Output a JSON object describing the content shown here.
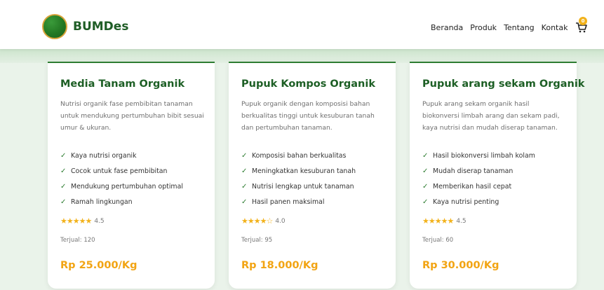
{
  "header": {
    "brand": "BUMDes",
    "nav": [
      "Beranda",
      "Produk",
      "Tentang",
      "Kontak"
    ],
    "cart_count": "0"
  },
  "products": [
    {
      "title": "Media Tanam Organik",
      "description": "Nutrisi organik fase pembibitan tanaman untuk mendukung pertumbuhan bibit sesuai umur & ukuran.",
      "features": [
        "Kaya nutrisi organik",
        "Cocok untuk fase pembibitan",
        "Mendukung pertumbuhan optimal",
        "Ramah lingkungan"
      ],
      "stars": "★★★★★",
      "rating": "4.5",
      "sold": "Terjual: 120",
      "price": "Rp 25.000/Kg"
    },
    {
      "title": "Pupuk Kompos Organik",
      "description": "Pupuk organik dengan komposisi bahan berkualitas tinggi untuk kesuburan tanah dan pertumbuhan tanaman.",
      "features": [
        "Komposisi bahan berkualitas",
        "Meningkatkan kesuburan tanah",
        "Nutrisi lengkap untuk tanaman",
        "Hasil panen maksimal"
      ],
      "stars": "★★★★☆",
      "rating": "4.0",
      "sold": "Terjual: 95",
      "price": "Rp 18.000/Kg"
    },
    {
      "title": "Pupuk arang sekam Organik",
      "description": "Pupuk arang sekam organik hasil biokonversi limbah arang dan sekam padi, kaya nutrisi dan mudah diserap tanaman.",
      "features": [
        "Hasil biokonversi limbah kolam",
        "Mudah diserap tanaman",
        "Memberikan hasil cepat",
        "Kaya nutrisi penting"
      ],
      "stars": "★★★★★",
      "rating": "4.5",
      "sold": "Terjual: 60",
      "price": "Rp 30.000/Kg"
    }
  ]
}
